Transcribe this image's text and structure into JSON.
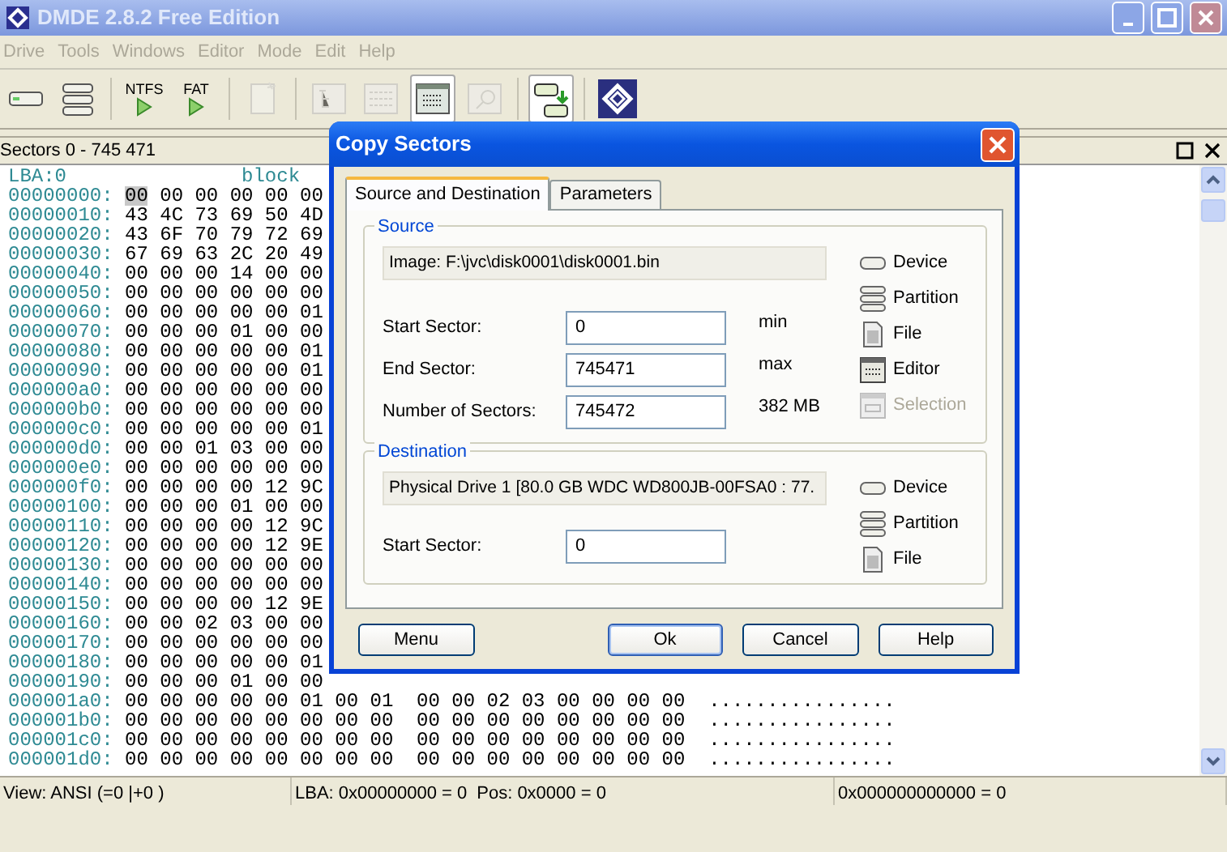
{
  "window": {
    "title": "DMDE 2.8.2 Free Edition"
  },
  "menu": [
    {
      "label": "Drive",
      "disabled": true
    },
    {
      "label": "Tools",
      "disabled": true
    },
    {
      "label": "Windows",
      "disabled": true
    },
    {
      "label": "Editor",
      "disabled": true
    },
    {
      "label": "Mode",
      "disabled": true
    },
    {
      "label": "Edit",
      "disabled": true
    },
    {
      "label": "Help",
      "disabled": true
    }
  ],
  "toolbar": [
    {
      "kind": "drive",
      "disabled": false,
      "pressed": false
    },
    {
      "kind": "partition",
      "disabled": false,
      "pressed": false
    },
    {
      "kind": "play",
      "label": "NTFS",
      "disabled": false,
      "pressed": false
    },
    {
      "kind": "play",
      "label": "FAT",
      "disabled": false,
      "pressed": false
    },
    {
      "kind": "new",
      "disabled": true,
      "pressed": false
    },
    {
      "kind": "tree",
      "disabled": true,
      "pressed": false
    },
    {
      "kind": "list",
      "disabled": true,
      "pressed": false
    },
    {
      "kind": "editor",
      "disabled": false,
      "pressed": true
    },
    {
      "kind": "search",
      "disabled": true,
      "pressed": false
    },
    {
      "kind": "copy",
      "disabled": false,
      "pressed": true
    },
    {
      "kind": "logo",
      "disabled": false,
      "pressed": false
    }
  ],
  "panel": {
    "title": "Sectors 0 - 745 471"
  },
  "hex": {
    "header_left": "LBA:0",
    "header_right": "block",
    "rows": [
      {
        "offset": "00000000:",
        "bytes": "00 00 00 00 00 00",
        "cursor": true
      },
      {
        "offset": "00000010:",
        "bytes": "43 4C 73 69 50 4D",
        "cursor": false
      },
      {
        "offset": "00000020:",
        "bytes": "43 6F 70 79 72 69",
        "cursor": false
      },
      {
        "offset": "00000030:",
        "bytes": "67 69 63 2C 20 49",
        "cursor": false
      },
      {
        "offset": "00000040:",
        "bytes": "00 00 00 14 00 00",
        "cursor": false
      },
      {
        "offset": "00000050:",
        "bytes": "00 00 00 00 00 00",
        "cursor": false
      },
      {
        "offset": "00000060:",
        "bytes": "00 00 00 00 00 01",
        "cursor": false
      },
      {
        "offset": "00000070:",
        "bytes": "00 00 00 01 00 00",
        "cursor": false
      },
      {
        "offset": "00000080:",
        "bytes": "00 00 00 00 00 01",
        "cursor": false
      },
      {
        "offset": "00000090:",
        "bytes": "00 00 00 00 00 01",
        "cursor": false
      },
      {
        "offset": "000000a0:",
        "bytes": "00 00 00 00 00 00",
        "cursor": false
      },
      {
        "offset": "000000b0:",
        "bytes": "00 00 00 00 00 00",
        "cursor": false
      },
      {
        "offset": "000000c0:",
        "bytes": "00 00 00 00 00 01",
        "cursor": false
      },
      {
        "offset": "000000d0:",
        "bytes": "00 00 01 03 00 00",
        "cursor": false
      },
      {
        "offset": "000000e0:",
        "bytes": "00 00 00 00 00 00",
        "cursor": false
      },
      {
        "offset": "000000f0:",
        "bytes": "00 00 00 00 12 9C",
        "cursor": false
      },
      {
        "offset": "00000100:",
        "bytes": "00 00 00 01 00 00",
        "cursor": false
      },
      {
        "offset": "00000110:",
        "bytes": "00 00 00 00 12 9C",
        "cursor": false
      },
      {
        "offset": "00000120:",
        "bytes": "00 00 00 00 12 9E",
        "cursor": false
      },
      {
        "offset": "00000130:",
        "bytes": "00 00 00 00 00 00",
        "cursor": false
      },
      {
        "offset": "00000140:",
        "bytes": "00 00 00 00 00 00",
        "cursor": false
      },
      {
        "offset": "00000150:",
        "bytes": "00 00 00 00 12 9E",
        "cursor": false
      },
      {
        "offset": "00000160:",
        "bytes": "00 00 02 03 00 00",
        "cursor": false
      },
      {
        "offset": "00000170:",
        "bytes": "00 00 00 00 00 00",
        "cursor": false
      },
      {
        "offset": "00000180:",
        "bytes": "00 00 00 00 00 01",
        "cursor": false
      },
      {
        "offset": "00000190:",
        "bytes": "00 00 00 01 00 00",
        "cursor": false
      },
      {
        "offset": "000001a0:",
        "bytes": "00 00 00 00 00 01 00 01  00 00 02 03 00 00 00 00",
        "text": "................",
        "cursor": false
      },
      {
        "offset": "000001b0:",
        "bytes": "00 00 00 00 00 00 00 00  00 00 00 00 00 00 00 00",
        "text": "................",
        "cursor": false
      },
      {
        "offset": "000001c0:",
        "bytes": "00 00 00 00 00 00 00 00  00 00 00 00 00 00 00 00",
        "text": "................",
        "cursor": false
      },
      {
        "offset": "000001d0:",
        "bytes": "00 00 00 00 00 00 00 00  00 00 00 00 00 00 00 00",
        "text": "................",
        "cursor": false
      }
    ]
  },
  "status_bar": [
    {
      "texts": [
        "View: ANSI (=0 |+0 )"
      ]
    },
    {
      "texts": [
        "LBA: 0x00000000 = 0",
        "Pos: 0x0000 = 0"
      ]
    },
    {
      "texts": [
        "0x000000000000 = 0"
      ]
    }
  ],
  "dialog": {
    "title": "Copy Sectors",
    "tabs": [
      {
        "label": "Source and Destination",
        "selected": true
      },
      {
        "label": "Parameters",
        "selected": false
      }
    ],
    "groups": [
      {
        "legend": "Source",
        "path": "Image: F:\\jvc\\disk0001\\disk0001.bin",
        "fields": [
          {
            "label": "Start Sector:",
            "value": "0",
            "note": "min"
          },
          {
            "label": "End Sector:",
            "value": "745471",
            "note": "max"
          },
          {
            "label": "Number of Sectors:",
            "value": "745472",
            "note": "382 MB"
          }
        ],
        "options": [
          {
            "kind": "device",
            "label": "Device",
            "disabled": false
          },
          {
            "kind": "partition",
            "label": "Partition",
            "disabled": false
          },
          {
            "kind": "file",
            "label": "File",
            "disabled": false
          },
          {
            "kind": "editor",
            "label": "Editor",
            "disabled": false
          },
          {
            "kind": "selection",
            "label": "Selection",
            "disabled": true
          }
        ]
      },
      {
        "legend": "Destination",
        "path": "Physical Drive 1 [80.0 GB WDC WD800JB-00FSA0 : 77.",
        "fields": [
          {
            "label": "Start Sector:",
            "value": "0"
          }
        ],
        "options": [
          {
            "kind": "device",
            "label": "Device",
            "disabled": false
          },
          {
            "kind": "partition",
            "label": "Partition",
            "disabled": false
          },
          {
            "kind": "file",
            "label": "File",
            "disabled": false
          }
        ]
      }
    ],
    "buttons": [
      {
        "label": "Menu",
        "default": false
      },
      {
        "label": "Ok",
        "default": true
      },
      {
        "label": "Cancel",
        "default": false
      },
      {
        "label": "Help",
        "default": false
      }
    ]
  }
}
